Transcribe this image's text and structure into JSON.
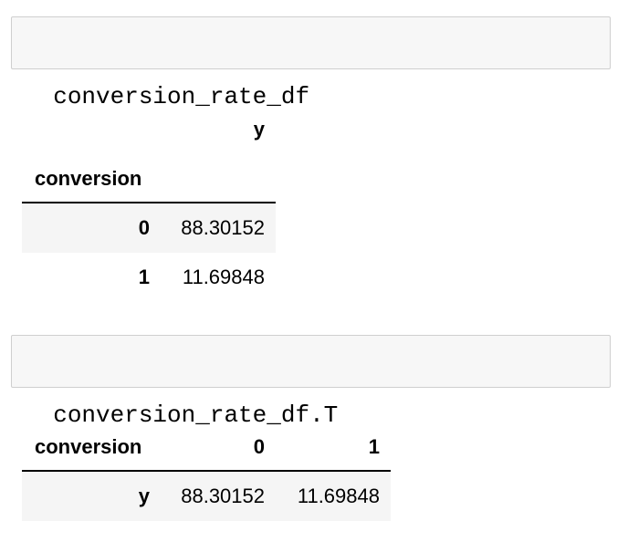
{
  "cells": [
    {
      "code": "conversion_rate_df"
    },
    {
      "code": "conversion_rate_df.T"
    }
  ],
  "table1": {
    "column_header": "y",
    "index_name": "conversion",
    "rows": [
      {
        "index": "0",
        "y": "88.30152"
      },
      {
        "index": "1",
        "y": "11.69848"
      }
    ]
  },
  "table2": {
    "index_name": "conversion",
    "columns": [
      "0",
      "1"
    ],
    "rows": [
      {
        "index": "y",
        "values": [
          "88.30152",
          "11.69848"
        ]
      }
    ]
  }
}
